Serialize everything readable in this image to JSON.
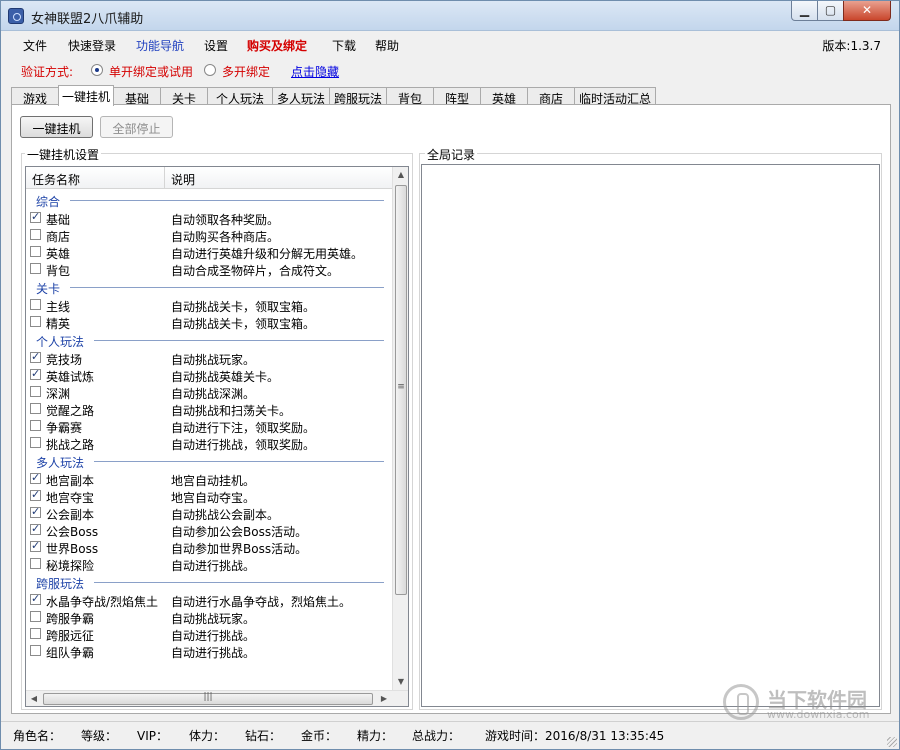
{
  "window": {
    "title": "女神联盟2八爪辅助"
  },
  "menu": [
    {
      "label": "文件",
      "color": "#000000"
    },
    {
      "label": "快速登录",
      "color": "#000000"
    },
    {
      "label": "功能导航",
      "color": "#1f3fbf"
    },
    {
      "label": "设置",
      "color": "#000000"
    },
    {
      "label": "购买及绑定",
      "color": "#d40000"
    },
    {
      "label": "下载",
      "color": "#000000"
    },
    {
      "label": "帮助",
      "color": "#000000"
    }
  ],
  "version": "版本:1.3.7",
  "verify": {
    "label": "验证方式:",
    "options": [
      {
        "label": "单开绑定或试用",
        "selected": true
      },
      {
        "label": "多开绑定",
        "selected": false
      }
    ],
    "hide_link": "点击隐藏"
  },
  "tabs": [
    "游戏",
    "一键挂机",
    "基础",
    "关卡",
    "个人玩法",
    "多人玩法",
    "跨服玩法",
    "背包",
    "阵型",
    "英雄",
    "商店",
    "临时活动汇总"
  ],
  "active_tab": 1,
  "buttons": {
    "start": "一键挂机",
    "stop_all": "全部停止"
  },
  "settings_group": {
    "title": "一键挂机设置",
    "col_name": "任务名称",
    "col_desc": "说明",
    "sections": [
      {
        "title": "综合",
        "items": [
          {
            "name": "基础",
            "desc": "自动领取各种奖励。",
            "checked": true
          },
          {
            "name": "商店",
            "desc": "自动购买各种商店。",
            "checked": false
          },
          {
            "name": "英雄",
            "desc": "自动进行英雄升级和分解无用英雄。",
            "checked": false
          },
          {
            "name": "背包",
            "desc": "自动合成圣物碎片，合成符文。",
            "checked": false
          }
        ]
      },
      {
        "title": "关卡",
        "items": [
          {
            "name": "主线",
            "desc": "自动挑战关卡，领取宝箱。",
            "checked": false
          },
          {
            "name": "精英",
            "desc": "自动挑战关卡，领取宝箱。",
            "checked": false
          }
        ]
      },
      {
        "title": "个人玩法",
        "items": [
          {
            "name": "竞技场",
            "desc": "自动挑战玩家。",
            "checked": true
          },
          {
            "name": "英雄试炼",
            "desc": "自动挑战英雄关卡。",
            "checked": true
          },
          {
            "name": "深渊",
            "desc": "自动挑战深渊。",
            "checked": false
          },
          {
            "name": "觉醒之路",
            "desc": "自动挑战和扫荡关卡。",
            "checked": false
          },
          {
            "name": "争霸赛",
            "desc": "自动进行下注，领取奖励。",
            "checked": false
          },
          {
            "name": "挑战之路",
            "desc": "自动进行挑战，领取奖励。",
            "checked": false
          }
        ]
      },
      {
        "title": "多人玩法",
        "items": [
          {
            "name": "地宫副本",
            "desc": "地宫自动挂机。",
            "checked": true
          },
          {
            "name": "地宫夺宝",
            "desc": "地宫自动夺宝。",
            "checked": true
          },
          {
            "name": "公会副本",
            "desc": "自动挑战公会副本。",
            "checked": true
          },
          {
            "name": "公会Boss",
            "desc": "自动参加公会Boss活动。",
            "checked": true
          },
          {
            "name": "世界Boss",
            "desc": "自动参加世界Boss活动。",
            "checked": true
          },
          {
            "name": "秘境探险",
            "desc": "自动进行挑战。",
            "checked": false
          }
        ]
      },
      {
        "title": "跨服玩法",
        "items": [
          {
            "name": "水晶争夺战/烈焰焦土",
            "desc": "自动进行水晶争夺战，烈焰焦土。",
            "checked": true
          },
          {
            "name": "跨服争霸",
            "desc": "自动挑战玩家。",
            "checked": false
          },
          {
            "name": "跨服远征",
            "desc": "自动进行挑战。",
            "checked": false
          },
          {
            "name": "组队争霸",
            "desc": "自动进行挑战。",
            "checked": false
          }
        ]
      }
    ]
  },
  "log_group": {
    "title": "全局记录"
  },
  "status": [
    {
      "label": "角色名："
    },
    {
      "label": "等级："
    },
    {
      "label": "VIP："
    },
    {
      "label": "体力："
    },
    {
      "label": "钻石："
    },
    {
      "label": "金币："
    },
    {
      "label": "精力："
    },
    {
      "label": "总战力："
    },
    {
      "label": "游戏时间：2016/8/31 13:35:45"
    }
  ],
  "watermark": {
    "text": "当下软件园",
    "url": "www.downxia.com"
  }
}
